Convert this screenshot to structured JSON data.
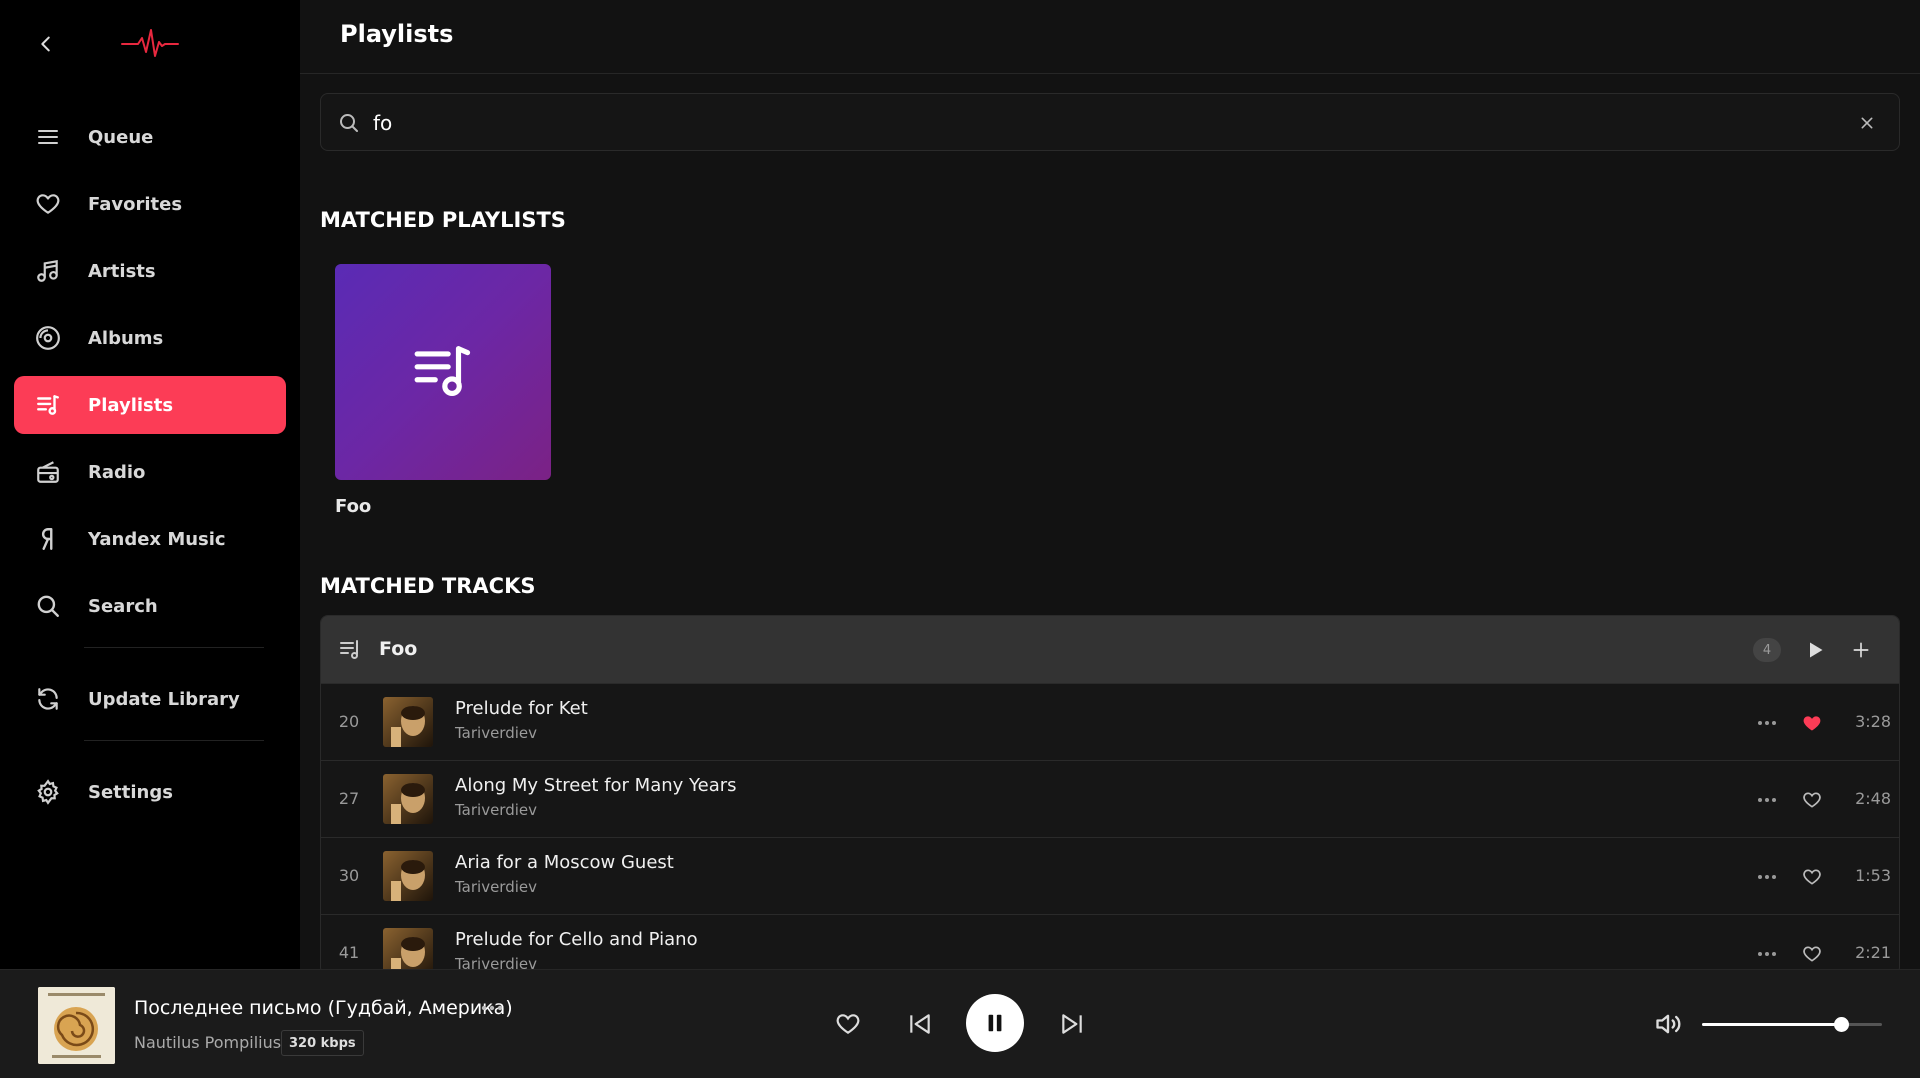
{
  "app": {
    "accent": "#fc3c56"
  },
  "sidebar": {
    "items": [
      {
        "label": "Queue",
        "icon": "queue-icon"
      },
      {
        "label": "Favorites",
        "icon": "heart-icon"
      },
      {
        "label": "Artists",
        "icon": "music-note-icon"
      },
      {
        "label": "Albums",
        "icon": "album-icon"
      },
      {
        "label": "Playlists",
        "icon": "playlist-icon",
        "active": true
      },
      {
        "label": "Radio",
        "icon": "radio-icon"
      },
      {
        "label": "Yandex Music",
        "icon": "yandex-icon"
      },
      {
        "label": "Search",
        "icon": "search-icon"
      }
    ],
    "update_library": "Update Library",
    "settings": "Settings"
  },
  "main": {
    "title": "Playlists",
    "search": {
      "value": "fo"
    },
    "matched_playlists_title": "MATCHED PLAYLISTS",
    "playlists": [
      {
        "name": "Foo"
      }
    ],
    "matched_tracks_title": "MATCHED TRACKS",
    "tracks_group": {
      "name": "Foo",
      "count": "4",
      "tracks": [
        {
          "num": "20",
          "title": "Prelude for Ket",
          "artist": "Tariverdiev",
          "duration": "3:28",
          "liked": true
        },
        {
          "num": "27",
          "title": "Along My Street for Many Years",
          "artist": "Tariverdiev",
          "duration": "2:48",
          "liked": false
        },
        {
          "num": "30",
          "title": "Aria for a Moscow Guest",
          "artist": "Tariverdiev",
          "duration": "1:53",
          "liked": false
        },
        {
          "num": "41",
          "title": "Prelude for Cello and Piano",
          "artist": "Tariverdiev",
          "duration": "2:21",
          "liked": false
        }
      ]
    }
  },
  "player": {
    "title": "Последнее письмо (Гудбай, Америка)",
    "artist": "Nautilus Pompilius",
    "bitrate": "320 kbps",
    "volume": 0.77
  }
}
